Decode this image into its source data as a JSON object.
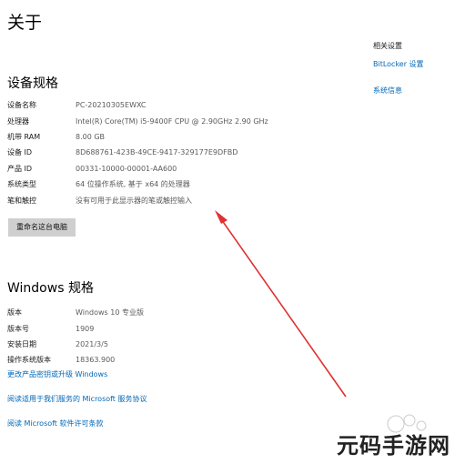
{
  "page": {
    "title": "关于"
  },
  "device_specs": {
    "title": "设备规格",
    "rows": [
      {
        "label": "设备名称",
        "value": "PC-20210305EWXC"
      },
      {
        "label": "处理器",
        "value": "Intel(R) Core(TM) i5-9400F CPU @ 2.90GHz   2.90 GHz"
      },
      {
        "label": "机带 RAM",
        "value": "8.00 GB"
      },
      {
        "label": "设备 ID",
        "value": "8D688761-423B-49CE-9417-329177E9DFBD"
      },
      {
        "label": "产品 ID",
        "value": "00331-10000-00001-AA600"
      },
      {
        "label": "系统类型",
        "value": "64 位操作系统, 基于 x64 的处理器"
      },
      {
        "label": "笔和触控",
        "value": "没有可用于此显示器的笔或触控输入"
      }
    ],
    "rename_button": "重命名这台电脑"
  },
  "windows_specs": {
    "title": "Windows 规格",
    "rows": [
      {
        "label": "版本",
        "value": "Windows 10 专业版"
      },
      {
        "label": "版本号",
        "value": "1909"
      },
      {
        "label": "安装日期",
        "value": "2021/3/5"
      },
      {
        "label": "操作系统版本",
        "value": "18363.900"
      }
    ],
    "links": [
      "更改产品密钥或升级 Windows",
      "阅读适用于我们服务的 Microsoft 服务协议",
      "阅读 Microsoft 软件许可条款"
    ]
  },
  "related_settings": {
    "title": "相关设置",
    "links": [
      "BitLocker 设置",
      "系统信息"
    ]
  },
  "watermark": {
    "text": "元码手游网"
  },
  "colors": {
    "link": "#0067b8",
    "arrow": "#e03030",
    "button": "#cfcfcf"
  }
}
